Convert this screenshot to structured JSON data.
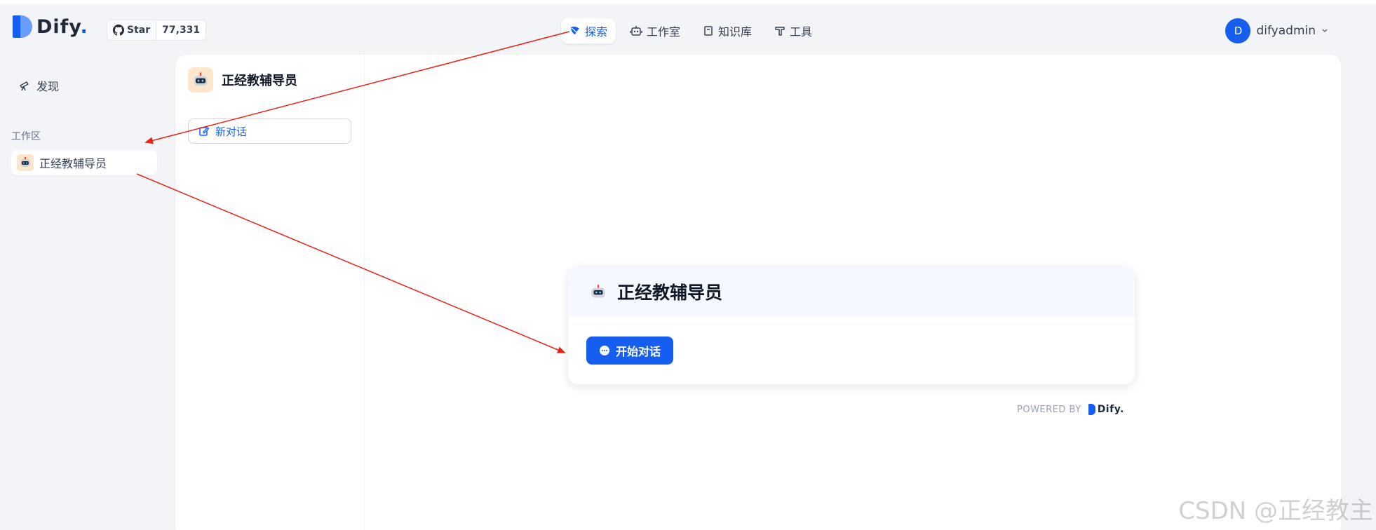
{
  "header": {
    "logo_text": "Dify",
    "logo_dot": ".",
    "github": {
      "label": "Star",
      "count": "77,331"
    },
    "nav": [
      {
        "label": "探索",
        "icon": "compass-icon",
        "active": true
      },
      {
        "label": "工作室",
        "icon": "robot-icon",
        "active": false
      },
      {
        "label": "知识库",
        "icon": "book-icon",
        "active": false
      },
      {
        "label": "工具",
        "icon": "hammer-icon",
        "active": false
      }
    ],
    "user": {
      "avatar_letter": "D",
      "name": "difyadmin"
    }
  },
  "sidebar": {
    "discover_label": "发现",
    "workspace_label": "工作区",
    "workspace_items": [
      {
        "label": "正经教辅导员",
        "icon": "robot-avatar-icon"
      }
    ]
  },
  "app": {
    "title": "正经教辅导员",
    "new_chat_label": "新对话"
  },
  "card": {
    "title": "正经教辅导员",
    "start_button": "开始对话"
  },
  "footer": {
    "powered_by": "POWERED BY",
    "powered_logo": "Dify."
  },
  "watermark": "CSDN @正经教主",
  "colors": {
    "accent": "#155eef",
    "annotation": "#e8231a",
    "background": "#f2f4f7"
  }
}
